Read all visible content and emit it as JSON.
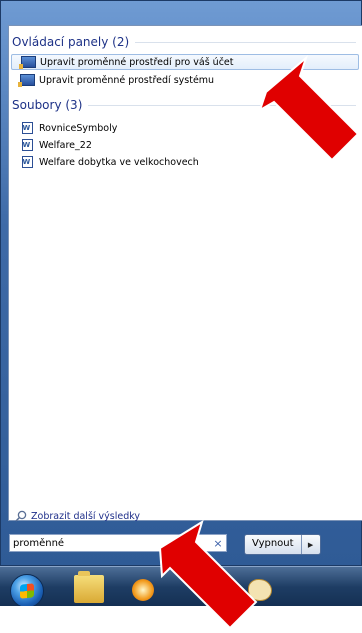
{
  "groups": {
    "control_panel": {
      "header": "Ovládací panely (2)",
      "items": [
        {
          "label": "Upravit proměnné prostředí pro váš účet"
        },
        {
          "label": "Upravit proměnné prostředí systému"
        }
      ]
    },
    "files": {
      "header": "Soubory (3)",
      "items": [
        {
          "label": "RovniceSymboly"
        },
        {
          "label": "Welfare_22"
        },
        {
          "label": "Welfare dobytka ve  velkochovech"
        }
      ]
    }
  },
  "more_results": "Zobrazit další výsledky",
  "search": {
    "value": "proměnné",
    "clear": "×"
  },
  "shutdown": {
    "label": "Vypnout",
    "arrow": "▶"
  },
  "icons": {
    "control_panel_item": "control-panel-icon",
    "file_item": "word-document-icon",
    "more": "search-icon",
    "start": "windows-start-orb",
    "taskbar": [
      "explorer-folder-icon",
      "media-player-icon",
      "paint-icon"
    ]
  },
  "colors": {
    "annotation_arrow": "#e00000",
    "header_text": "#1e3287"
  }
}
